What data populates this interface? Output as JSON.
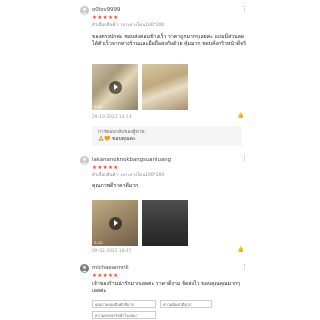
{
  "icons": {
    "more": "more-vertical-icon",
    "like": "thumb-up-icon",
    "play": "play-icon",
    "avatar": "user-avatar-icon"
  },
  "colors": {
    "star": "#ee4d2d"
  },
  "reviews": [
    {
      "username": "o0lov9999",
      "stars": "★★★★★",
      "variant": "ตัวเลือกสินค้า: เบาะยางโดน100*200",
      "text": "ของตรงปกค่ะ ชอบส่งค่อนข้างเร็ว ราคาถูกมากๆเลยค่ะ แถมมีส่วนลด ได้ตัวเร็วจากทางร้านและมือถือส่งกับด้วย คุ้มมาก ชอบคั่งกริวหน้าดีจริ",
      "video_length": "0:15",
      "date": "29-10-2021 14:13",
      "reply_title": "การตอบกลับของผู้ขาย:",
      "reply_text": "🙏🧡 ขอบคุณคะ"
    },
    {
      "username": "lakananoknokbangsuanluang",
      "stars": "★★★★★",
      "variant": "ตัวเลือกสินค้า: เบาะยางโดน100*200",
      "text": "คุณภาพดีราคาดีมาก",
      "video_length": "0:12",
      "date": "09-02-2022 18:47"
    },
    {
      "username": "michaeannrill",
      "stars": "★★★★★",
      "text": "เจ้าของร้านน่ารักมากเลยค่ะ ราคาดีงาม จัดส่งไว ขอบคุณคุณมากๆ เลยค่ะ",
      "tags": [
        "คุณภาพของสินค้าดีมาก",
        "ความคุ้มค่าดีมาก",
        "ความตรงปกรับคำโฆษณา"
      ]
    }
  ]
}
